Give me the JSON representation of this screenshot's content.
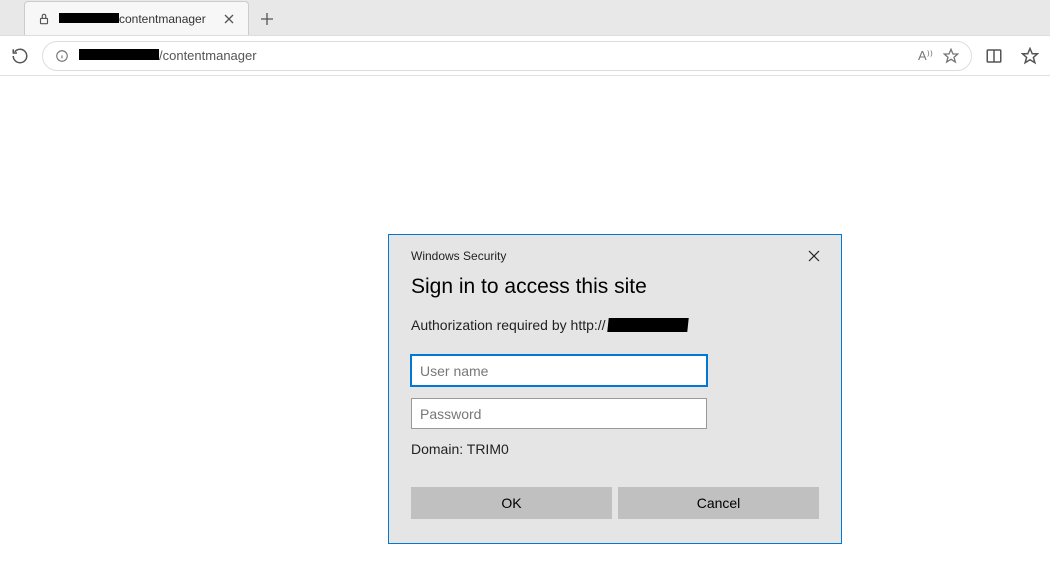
{
  "tab": {
    "redacted_prefix": true,
    "suffix": "contentmanager"
  },
  "address": {
    "redacted_prefix": true,
    "suffix": "/contentmanager"
  },
  "dialog": {
    "caption": "Windows Security",
    "title": "Sign in to access this site",
    "message_prefix": "Authorization required by http://",
    "message_redacted_host": true,
    "username_placeholder": "User name",
    "username_value": "",
    "password_placeholder": "Password",
    "password_value": "",
    "domain_label": "Domain: TRIM0",
    "ok_label": "OK",
    "cancel_label": "Cancel"
  }
}
